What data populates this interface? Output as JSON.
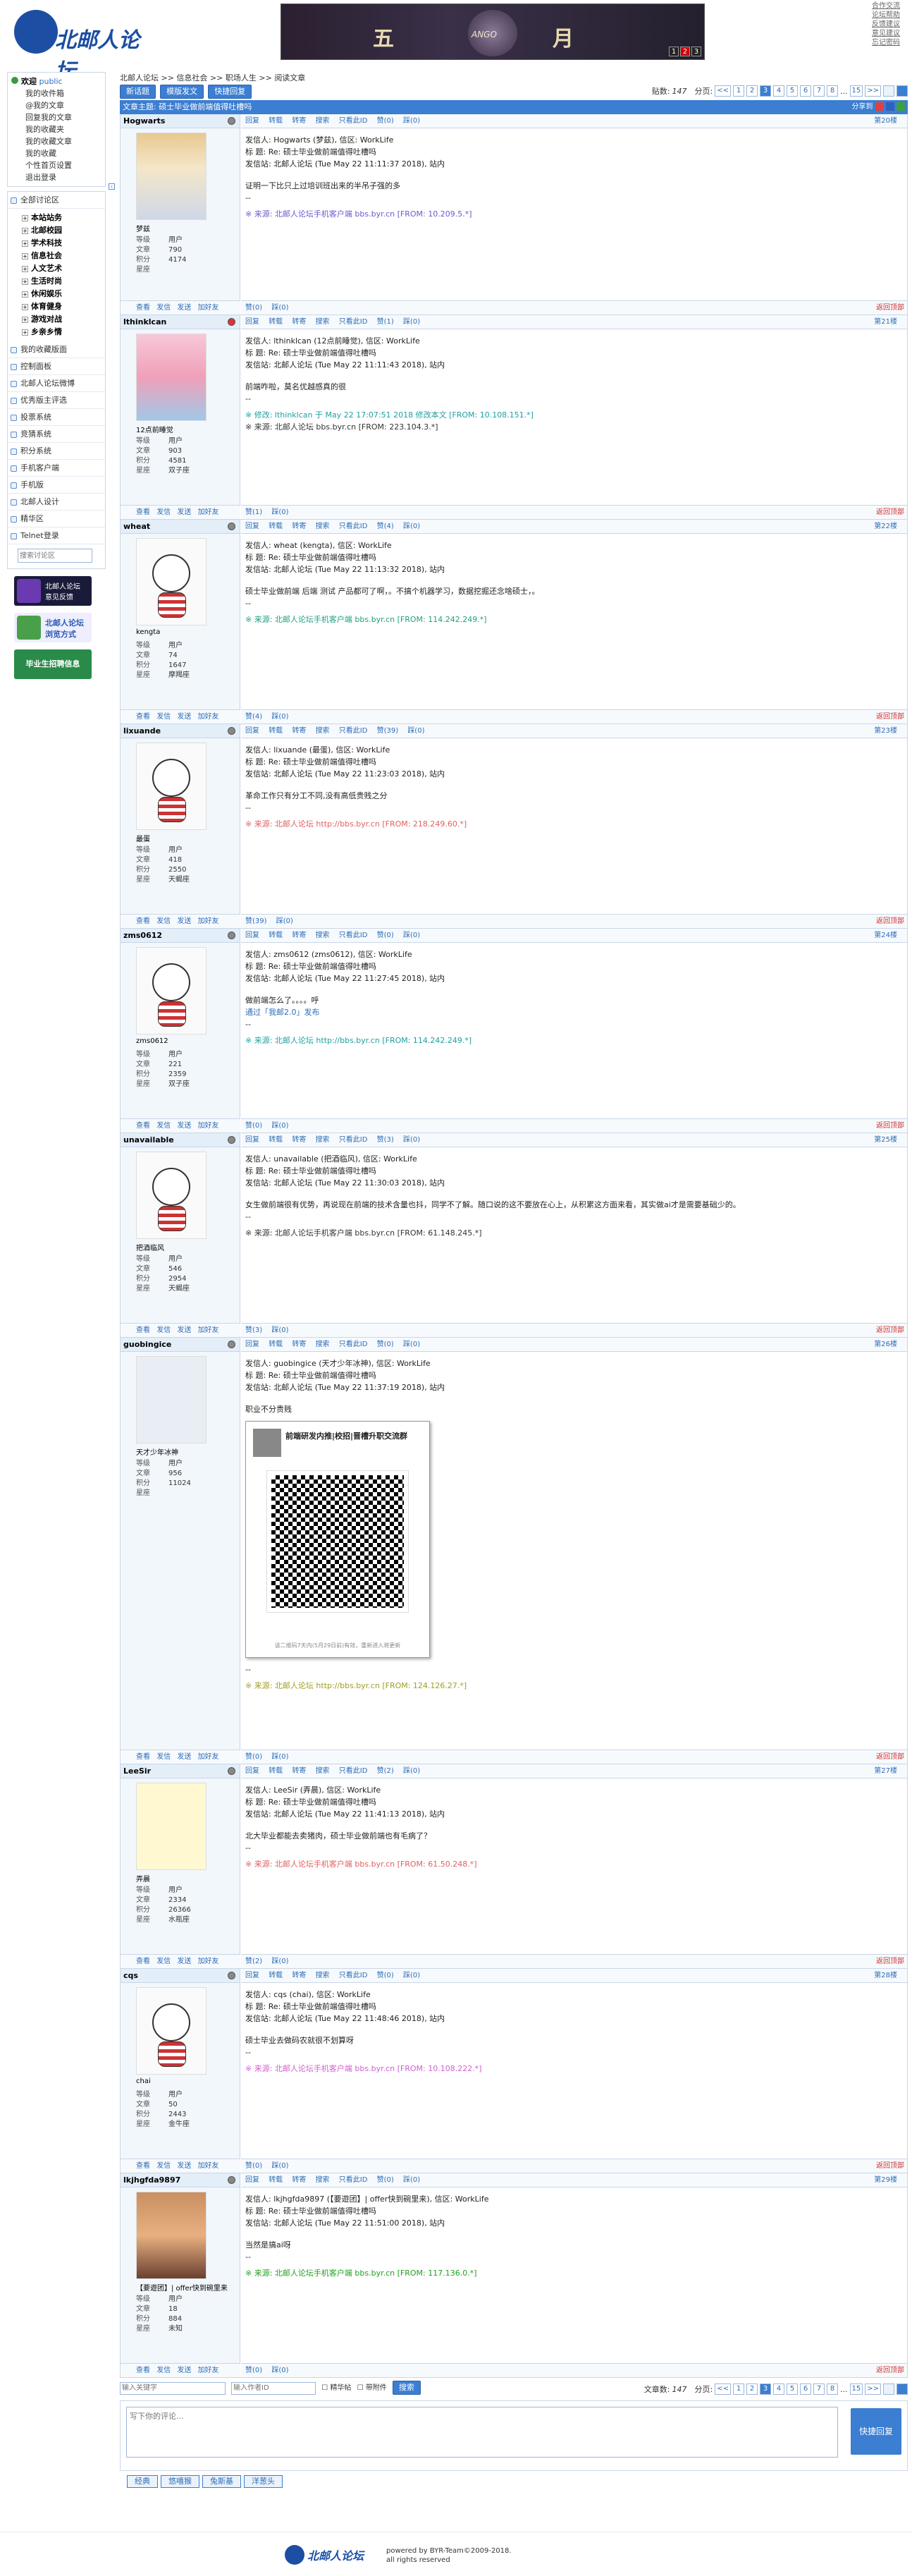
{
  "header": {
    "logo_text": "北邮人论坛",
    "banner_left": "五",
    "banner_right": "月",
    "banner_mid": "ANGO",
    "banner_pages": [
      "1",
      "2",
      "3"
    ],
    "top_links": [
      "合作交流",
      "论坛帮助",
      "反馈建议",
      "意见建议",
      "忘记密码"
    ]
  },
  "sidebar": {
    "welcome": "欢迎",
    "user": "public",
    "links": [
      "我的收件箱",
      "@我的文章",
      "回复我的文章",
      "我的收藏夹",
      "我的收藏文章",
      "我的收藏",
      "个性首页设置",
      "退出登录"
    ],
    "all_sections": "全部讨论区",
    "sections": [
      "本站站务",
      "北邮校园",
      "学术科技",
      "信息社会",
      "人文艺术",
      "生活时尚",
      "休闲娱乐",
      "体育健身",
      "游戏对战",
      "乡亲乡情"
    ],
    "menu": [
      "我的收藏版面",
      "控制面板",
      "北邮人论坛微博",
      "优秀版主评选",
      "投票系统",
      "竞猜系统",
      "积分系统",
      "手机客户端",
      "手机版",
      "北邮人设计",
      "精华区",
      "Telnet登录"
    ],
    "search_placeholder": "搜索讨论区",
    "ad1": "北邮人论坛 意见反馈",
    "ad2": "北邮人论坛 浏览方式",
    "ad3": "毕业生招聘信息"
  },
  "main": {
    "breadcrumb": [
      "北邮人论坛",
      ">>",
      "信息社会",
      ">>",
      "职场人生",
      ">>",
      "阅读文章"
    ],
    "buttons": {
      "new": "新话题",
      "template": "模版发文",
      "quick": "快捷回复"
    },
    "post_count_label": "贴数:",
    "post_count": "147",
    "page_label": "分页:",
    "pages": [
      "<<",
      "1",
      "2",
      "3",
      "4",
      "5",
      "6",
      "7",
      "8",
      "...",
      "15",
      ">>"
    ],
    "title_prefix": "文章主题:",
    "title": "硕士毕业做前端值得吐槽吗",
    "title_right": "分享到",
    "actions": [
      "回复",
      "转载",
      "转寄",
      "搜索",
      "只看此ID",
      "赞",
      "踩"
    ],
    "stat_labels": [
      "等级",
      "文章",
      "积分",
      "星座"
    ],
    "foot_actions": [
      "查看",
      "发信",
      "发送",
      "加好友"
    ],
    "back_top": "返回顶部"
  },
  "posts": [
    {
      "id": "Hogwarts",
      "nick": "梦兹",
      "online": false,
      "floor": "第20楼",
      "level": "用户",
      "articles": "790",
      "score": "4174",
      "star": "",
      "from": "发信人: Hogwarts (梦兹), 信区: WorkLife",
      "subject": "标  题: Re: 硕士毕业做前端值得吐槽吗",
      "station": "发信站: 北邮人论坛 (Tue May 22 11:11:37 2018), 站内",
      "content": "证明一下比只上过培训班出来的半吊子强的多",
      "like": "赞(0)",
      "dislike": "踩(0)",
      "source": "※ 来源: 北邮人论坛手机客户端 bbs.byr.cn [FROM: 10.209.5.*]",
      "srccolor": "#6a5acd"
    },
    {
      "id": "lthinklcan",
      "nick": "12点前睡觉",
      "online": true,
      "floor": "第21楼",
      "level": "用户",
      "articles": "903",
      "score": "4581",
      "star": "双子座",
      "from": "发信人: lthinklcan (12点前睡觉), 信区: WorkLife",
      "subject": "标  题: Re: 硕士毕业做前端值得吐槽吗",
      "station": "发信站: 北邮人论坛 (Tue May 22 11:11:43 2018), 站内",
      "content": "前端咋啦，莫名优越感真的很",
      "like": "赞(1)",
      "dislike": "踩(0)",
      "source": "※ 修改: lthinklcan 于 May 22 17:07:51 2018 修改本文 [FROM: 10.108.151.*]",
      "source2": "※ 来源: 北邮人论坛 bbs.byr.cn [FROM: 223.104.3.*]",
      "srccolor": "#20a0a0"
    },
    {
      "id": "wheat",
      "nick": "kengta",
      "online": false,
      "floor": "第22楼",
      "level": "用户",
      "articles": "74",
      "score": "1647",
      "star": "摩羯座",
      "from": "发信人: wheat (kengta), 信区: WorkLife",
      "subject": "标  题: Re: 硕士毕业做前端值得吐槽吗",
      "station": "发信站: 北邮人论坛 (Tue May 22 11:13:32 2018), 站内",
      "content": "硕士毕业做前端 后端 测试 产品都可了啊，。不搞个机器学习，数据挖掘还念啥硕士，。",
      "like": "赞(4)",
      "dislike": "踩(0)",
      "source": "※ 来源: 北邮人论坛手机客户端 bbs.byr.cn [FROM: 114.242.249.*]",
      "srccolor": "#20a080"
    },
    {
      "id": "lixuande",
      "nick": "最蛋",
      "online": false,
      "floor": "第23楼",
      "level": "用户",
      "articles": "418",
      "score": "2550",
      "star": "天蝎座",
      "from": "发信人: lixuande (最蛋), 信区: WorkLife",
      "subject": "标  题: Re: 硕士毕业做前端值得吐槽吗",
      "station": "发信站: 北邮人论坛 (Tue May 22 11:23:03 2018), 站内",
      "content": "革命工作只有分工不同,没有高低贵贱之分",
      "like": "赞(39)",
      "dislike": "踩(0)",
      "source": "※ 来源: 北邮人论坛 http://bbs.byr.cn [FROM: 218.249.60.*]",
      "srccolor": "#e06060"
    },
    {
      "id": "zms0612",
      "nick": "zms0612",
      "online": false,
      "floor": "第24楼",
      "level": "用户",
      "articles": "221",
      "score": "2359",
      "star": "双子座",
      "from": "发信人: zms0612 (zms0612), 信区: WorkLife",
      "subject": "标  题: Re: 硕士毕业做前端值得吐槽吗",
      "station": "发信站: 北邮人论坛 (Tue May 22 11:27:45 2018), 站内",
      "content": "做前端怎么了。。。。呼",
      "extra": "通过「我邮2.0」发布",
      "like": "赞(0)",
      "dislike": "踩(0)",
      "source": "※ 来源: 北邮人论坛 http://bbs.byr.cn [FROM: 114.242.249.*]",
      "srccolor": "#20a0a0"
    },
    {
      "id": "unavailable",
      "nick": "把酒临风",
      "online": false,
      "floor": "第25楼",
      "level": "用户",
      "articles": "546",
      "score": "2954",
      "star": "天蝎座",
      "from": "发信人: unavailable (把酒临风), 信区: WorkLife",
      "subject": "标  题: Re: 硕士毕业做前端值得吐槽吗",
      "station": "发信站: 北邮人论坛 (Tue May 22 11:30:03 2018), 站内",
      "content": "女生做前端很有优势，再说现在前端的技术含量也抖，同学不了解。随口说的这不要放在心上，从积累这方面来看，其实做ai才是需要基础少的。",
      "like": "赞(3)",
      "dislike": "踩(0)",
      "source": "※ 来源: 北邮人论坛手机客户端 bbs.byr.cn [FROM: 61.148.245.*]",
      "srccolor": "#333"
    },
    {
      "id": "guobingice",
      "nick": "天才少年冰神",
      "online": false,
      "floor": "第26楼",
      "level": "用户",
      "articles": "956",
      "score": "11024",
      "star": "",
      "from": "发信人: guobingice (天才少年冰神), 信区: WorkLife",
      "subject": "标  题: Re: 硕士毕业做前端值得吐槽吗",
      "station": "发信站: 北邮人论坛 (Tue May 22 11:37:19 2018), 站内",
      "content": "职业不分贵贱",
      "qr_title": "前端研发内推|校招|晋槽升职交流群",
      "qr_caption": "该二维码7天内(5月29日前)有效，重新进入将更新",
      "like": "赞(0)",
      "dislike": "踩(0)",
      "source": "※ 来源: 北邮人论坛 http://bbs.byr.cn [FROM: 124.126.27.*]",
      "srccolor": "#a0a020"
    },
    {
      "id": "LeeSir",
      "nick": "弄晨",
      "online": false,
      "floor": "第27楼",
      "level": "用户",
      "articles": "2334",
      "score": "26366",
      "star": "水瓶座",
      "from": "发信人: LeeSir (弄晨), 信区: WorkLife",
      "subject": "标  题: Re: 硕士毕业做前端值得吐槽吗",
      "station": "发信站: 北邮人论坛 (Tue May 22 11:41:13 2018), 站内",
      "content": "北大毕业都能去卖猪肉，硕士毕业做前端也有毛病了？",
      "like": "赞(2)",
      "dislike": "踩(0)",
      "source": "※ 来源: 北邮人论坛手机客户端 bbs.byr.cn [FROM: 61.50.248.*]",
      "srccolor": "#e06060"
    },
    {
      "id": "cqs",
      "nick": "chai",
      "online": false,
      "floor": "第28楼",
      "level": "用户",
      "articles": "50",
      "score": "2443",
      "star": "金牛座",
      "from": "发信人: cqs (chai), 信区: WorkLife",
      "subject": "标  题: Re: 硕士毕业做前端值得吐槽吗",
      "station": "发信站: 北邮人论坛 (Tue May 22 11:48:46 2018), 站内",
      "content": "硕士毕业去做码农就很不划算呀",
      "like": "赞(0)",
      "dislike": "踩(0)",
      "source": "※ 来源: 北邮人论坛手机客户端 bbs.byr.cn [FROM: 10.108.222.*]",
      "srccolor": "#d060d0"
    },
    {
      "id": "lkjhgfda9897",
      "nick": "【要遊团】| offer快到碗里来",
      "online": false,
      "floor": "第29楼",
      "level": "用户",
      "articles": "18",
      "score": "884",
      "star": "未知",
      "from": "发信人: lkjhgfda9897 (【要遊团】| offer快到碗里来), 信区: WorkLife",
      "subject": "标  题: Re: 硕士毕业做前端值得吐槽吗",
      "station": "发信站: 北邮人论坛 (Tue May 22 11:51:00 2018), 站内",
      "content": "当然是搞ai呀",
      "like": "赞(0)",
      "dislike": "踩(0)",
      "source": "※ 来源: 北邮人论坛手机客户端 bbs.byr.cn [FROM: 117.136.0.*]",
      "srccolor": "#20a020"
    }
  ],
  "bottom": {
    "kw_placeholder": "输入关键字",
    "author_placeholder": "输入作者ID",
    "elite": "精华帖",
    "attach": "带附件",
    "search_btn": "搜索",
    "count_label": "文章数:",
    "count": "147",
    "reply_placeholder": "写下你的评论...",
    "quick_reply": "快捷回复",
    "emos": [
      "经典",
      "悠嘻猴",
      "兔斯基",
      "洋葱头"
    ]
  },
  "footer": {
    "powered": "powered by BYR-Team©2009-2018.",
    "rights": "all rights reserved"
  },
  "colors": {
    "accent": "#3b7ed2",
    "border": "#c9d6e6",
    "panel": "#f2f7fc"
  }
}
